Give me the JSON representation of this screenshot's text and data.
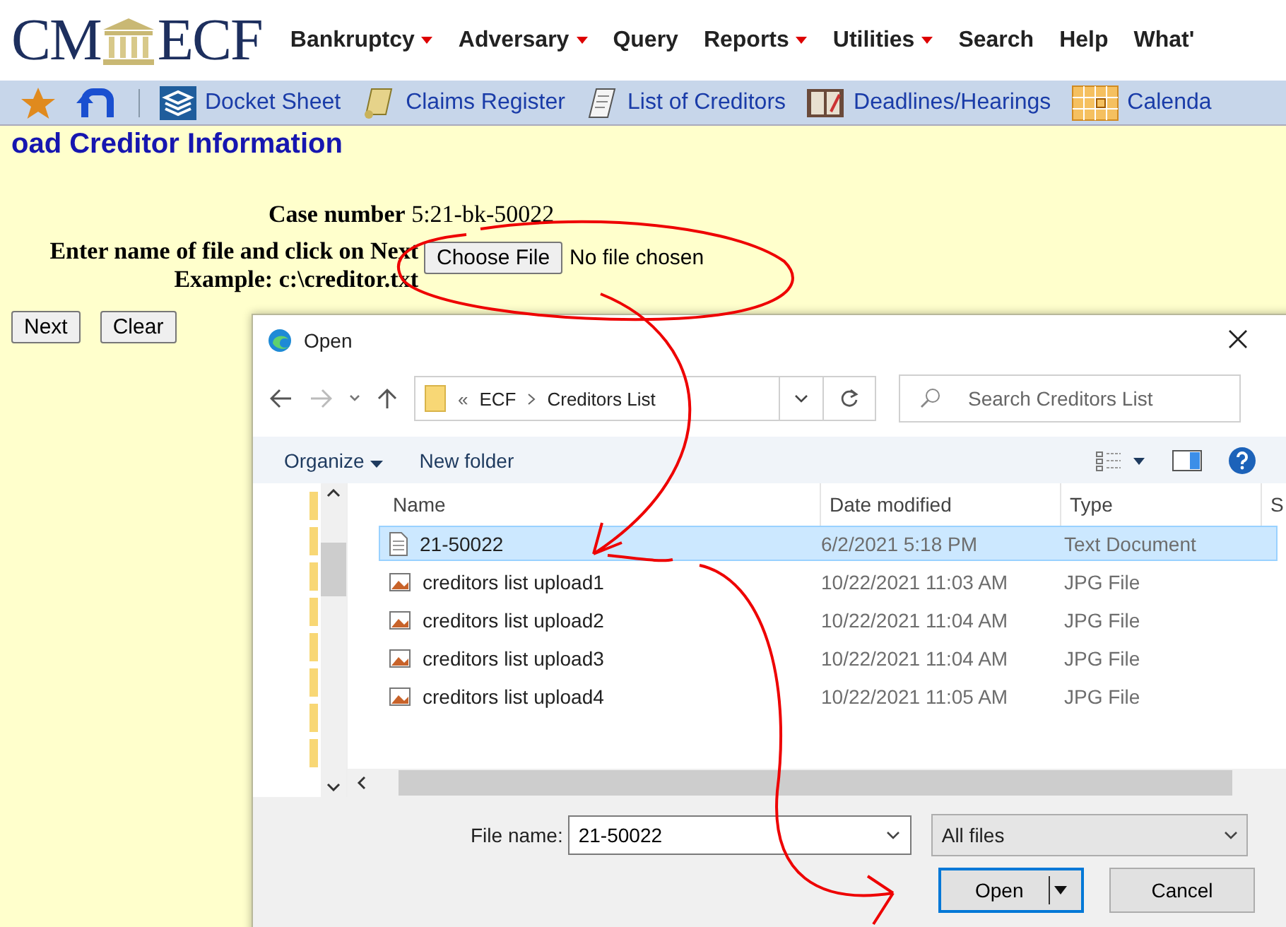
{
  "logo": {
    "left": "CM",
    "right": "ECF"
  },
  "menu": [
    {
      "label": "Bankruptcy",
      "dropdown": true
    },
    {
      "label": "Adversary",
      "dropdown": true
    },
    {
      "label": "Query",
      "dropdown": false
    },
    {
      "label": "Reports",
      "dropdown": true
    },
    {
      "label": "Utilities",
      "dropdown": true
    },
    {
      "label": "Search",
      "dropdown": false
    },
    {
      "label": "Help",
      "dropdown": false
    },
    {
      "label": "What'",
      "dropdown": false
    }
  ],
  "toolbar": [
    {
      "label": "Docket Sheet",
      "kind": "docket"
    },
    {
      "label": "Claims Register",
      "kind": "scroll"
    },
    {
      "label": "List of Creditors",
      "kind": "page"
    },
    {
      "label": "Deadlines/Hearings",
      "kind": "book"
    },
    {
      "label": "Calenda",
      "kind": "calendar"
    }
  ],
  "form": {
    "heading": "oad Creditor Information",
    "case_label": "Case number",
    "case_number": "5:21-bk-50022",
    "prompt": "Enter name of file and click on Next",
    "example": "Example: c:\\creditor.txt",
    "choose_button": "Choose File",
    "file_status": "No file chosen",
    "buttons": [
      "Next",
      "Clear"
    ]
  },
  "dialog": {
    "title": "Open",
    "path": [
      "«",
      "ECF",
      "Creditors List"
    ],
    "search": {
      "placeholder": "Search Creditors List"
    },
    "commands": [
      "Organize",
      "New folder"
    ],
    "columns": [
      "Name",
      "Date modified",
      "Type",
      "S"
    ],
    "files": [
      {
        "name": "21-50022",
        "date": "6/2/2021 5:18 PM",
        "type": "Text Document",
        "kind": "text",
        "selected": true
      },
      {
        "name": "creditors list upload1",
        "date": "10/22/2021 11:03 AM",
        "type": "JPG File",
        "kind": "image",
        "selected": false
      },
      {
        "name": "creditors list upload2",
        "date": "10/22/2021 11:04 AM",
        "type": "JPG File",
        "kind": "image",
        "selected": false
      },
      {
        "name": "creditors list upload3",
        "date": "10/22/2021 11:04 AM",
        "type": "JPG File",
        "kind": "image",
        "selected": false
      },
      {
        "name": "creditors list upload4",
        "date": "10/22/2021 11:05 AM",
        "type": "JPG File",
        "kind": "image",
        "selected": false
      }
    ],
    "filename_label": "File name:",
    "filename": {
      "value": "21-50022"
    },
    "filter": "All files",
    "open": "Open",
    "cancel": "Cancel"
  }
}
